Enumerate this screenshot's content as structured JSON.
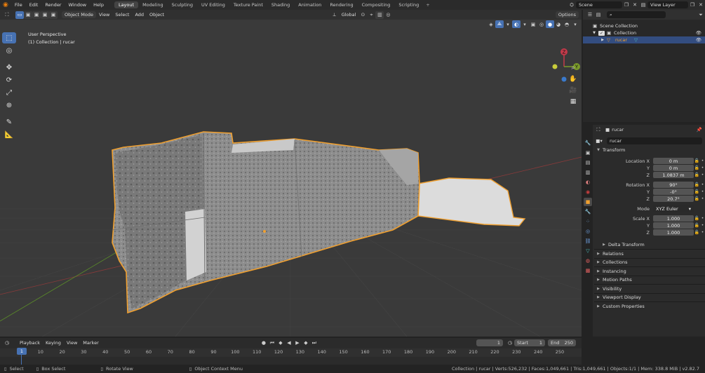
{
  "topbar": {
    "menus": [
      "File",
      "Edit",
      "Render",
      "Window",
      "Help"
    ],
    "workspaces": [
      "Layout",
      "Modeling",
      "Sculpting",
      "UV Editing",
      "Texture Paint",
      "Shading",
      "Animation",
      "Rendering",
      "Compositing",
      "Scripting"
    ],
    "active_workspace": "Layout",
    "plus": "+",
    "scene": "Scene",
    "view_layer": "View Layer"
  },
  "viewport_header": {
    "mode": "Object Mode",
    "menus": [
      "View",
      "Select",
      "Add",
      "Object"
    ],
    "orientation": "Global",
    "options": "Options"
  },
  "viewport": {
    "perspective": "User Perspective",
    "collection_info": "(1) Collection | rucar",
    "gizmo": {
      "z": "Z",
      "y": "Y"
    }
  },
  "outliner": {
    "scene_collection": "Scene Collection",
    "collection": "Collection",
    "object": "rucar"
  },
  "properties": {
    "object_name": "rucar",
    "datablock_name": "rucar",
    "transform_label": "Transform",
    "location": {
      "x_label": "Location X",
      "y_label": "Y",
      "z_label": "Z",
      "x": "0 m",
      "y": "0 m",
      "z": "1.0837 m"
    },
    "rotation": {
      "x_label": "Rotation X",
      "y_label": "Y",
      "z_label": "Z",
      "x": "90°",
      "y": "-0°",
      "z": "20.7°"
    },
    "mode_label": "Mode",
    "mode_value": "XYZ Euler",
    "scale": {
      "x_label": "Scale X",
      "y_label": "Y",
      "z_label": "Z",
      "x": "1.000",
      "y": "1.000",
      "z": "1.000"
    },
    "delta_transform": "Delta Transform",
    "panels": [
      "Relations",
      "Collections",
      "Instancing",
      "Motion Paths",
      "Visibility",
      "Viewport Display",
      "Custom Properties"
    ]
  },
  "timeline": {
    "menus": [
      "Playback",
      "Keying",
      "View",
      "Marker"
    ],
    "current_frame": "1",
    "start_label": "Start",
    "start": "1",
    "end_label": "End",
    "end": "250",
    "ticks": [
      "1",
      "10",
      "20",
      "30",
      "40",
      "50",
      "60",
      "70",
      "80",
      "90",
      "100",
      "110",
      "120",
      "130",
      "140",
      "150",
      "160",
      "170",
      "180",
      "190",
      "200",
      "210",
      "220",
      "230",
      "240",
      "250"
    ]
  },
  "statusbar": {
    "select": "Select",
    "box_select": "Box Select",
    "rotate_view": "Rotate View",
    "context_menu": "Object Context Menu",
    "stats": "Collection | rucar | Verts:526,232 | Faces:1,049,661 | Tris:1,049,661 | Objects:1/1 | Mem: 338.8 MiB | v2.82.7"
  },
  "colors": {
    "accent": "#4772b3",
    "selection_outline": "#f0a030",
    "mesh": "#8a8a8a",
    "viewport_bg": "#3a3a3a"
  }
}
